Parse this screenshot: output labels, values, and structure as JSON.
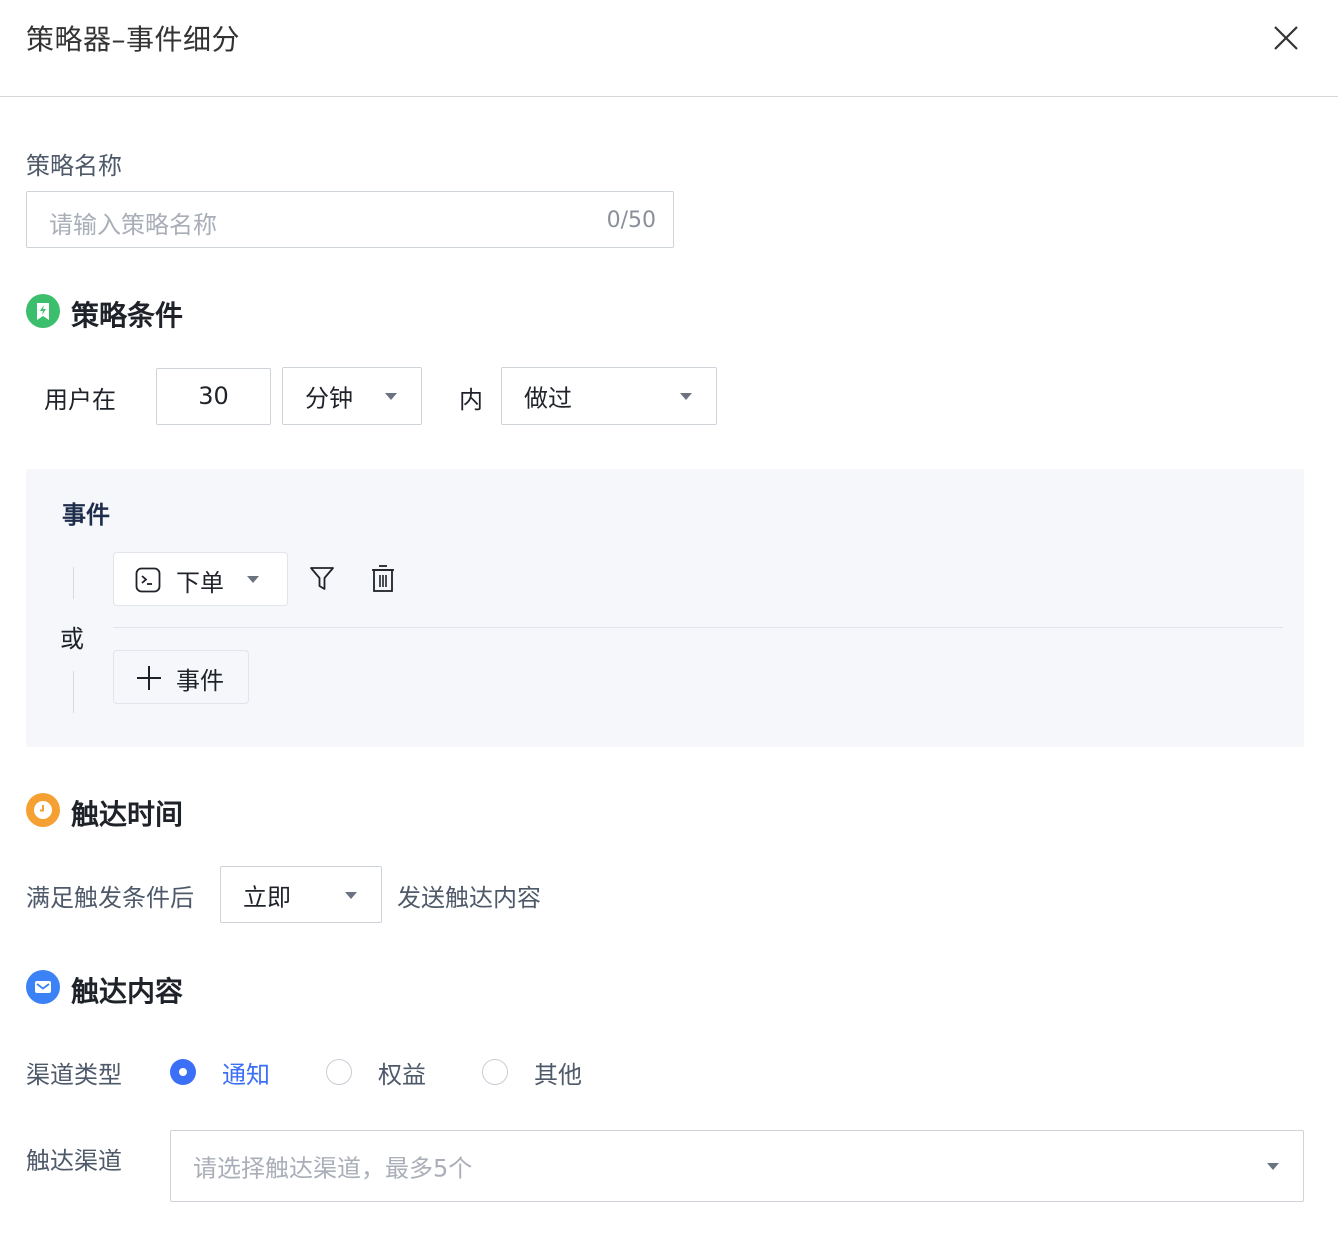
{
  "header": {
    "title": "策略器–事件细分"
  },
  "strategy_name": {
    "label": "策略名称",
    "placeholder": "请输入策略名称",
    "counter": "0/50"
  },
  "conditions": {
    "title": "策略条件",
    "icon_color": "#3cbf6c",
    "prefix": "用户在",
    "amount": "30",
    "unit": "分钟",
    "within": "内",
    "action": "做过"
  },
  "events": {
    "title": "事件",
    "or_label": "或",
    "items": [
      {
        "label": "下单"
      }
    ],
    "add_label": "事件"
  },
  "timing": {
    "title": "触达时间",
    "icon_color": "#f5a033",
    "prefix": "满足触发条件后",
    "value": "立即",
    "suffix": "发送触达内容"
  },
  "content": {
    "title": "触达内容",
    "icon_color": "#3b82f6",
    "channel_type_label": "渠道类型",
    "channel_types": [
      {
        "label": "通知",
        "selected": true
      },
      {
        "label": "权益",
        "selected": false
      },
      {
        "label": "其他",
        "selected": false
      }
    ],
    "channel_label": "触达渠道",
    "channel_placeholder": "请选择触达渠道，最多5个"
  },
  "colors": {
    "accent": "#3b6ff5",
    "panel_bg": "#f5f7fb"
  }
}
